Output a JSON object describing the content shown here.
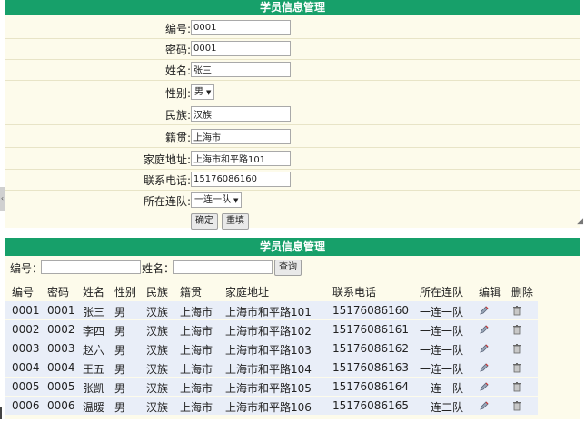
{
  "form": {
    "title": "学员信息管理",
    "fields": [
      {
        "label": "编号:",
        "value": "0001"
      },
      {
        "label": "密码:",
        "value": "0001"
      },
      {
        "label": "姓名:",
        "value": "张三"
      },
      {
        "label": "性别:",
        "value": "男"
      },
      {
        "label": "民族:",
        "value": "汉族"
      },
      {
        "label": "籍贯:",
        "value": "上海市"
      },
      {
        "label": "家庭地址:",
        "value": "上海市和平路101"
      },
      {
        "label": "联系电话:",
        "value": "15176086160"
      },
      {
        "label": "所在连队:",
        "value": "一连一队"
      }
    ],
    "confirm_label": "确定",
    "reset_label": "重填"
  },
  "list": {
    "title": "学员信息管理",
    "search": {
      "id_label": "编号：",
      "id_value": "",
      "name_label": "姓名：",
      "name_value": "",
      "button_label": "查询"
    },
    "headers": [
      "编号",
      "密码",
      "姓名",
      "性别",
      "民族",
      "籍贯",
      "家庭地址",
      "联系电话",
      "所在连队",
      "编辑",
      "删除"
    ],
    "rows": [
      {
        "id": "0001",
        "password": "0001",
        "name": "张三",
        "gender": "男",
        "ethnicity": "汉族",
        "native_place": "上海市",
        "address": "上海市和平路101",
        "phone": "15176086160",
        "team": "一连一队"
      },
      {
        "id": "0002",
        "password": "0002",
        "name": "李四",
        "gender": "男",
        "ethnicity": "汉族",
        "native_place": "上海市",
        "address": "上海市和平路102",
        "phone": "15176086161",
        "team": "一连一队"
      },
      {
        "id": "0003",
        "password": "0003",
        "name": "赵六",
        "gender": "男",
        "ethnicity": "汉族",
        "native_place": "上海市",
        "address": "上海市和平路103",
        "phone": "15176086162",
        "team": "一连一队"
      },
      {
        "id": "0004",
        "password": "0004",
        "name": "王五",
        "gender": "男",
        "ethnicity": "汉族",
        "native_place": "上海市",
        "address": "上海市和平路104",
        "phone": "15176086163",
        "team": "一连一队"
      },
      {
        "id": "0005",
        "password": "0005",
        "name": "张凯",
        "gender": "男",
        "ethnicity": "汉族",
        "native_place": "上海市",
        "address": "上海市和平路105",
        "phone": "15176086164",
        "team": "一连一队"
      },
      {
        "id": "0006",
        "password": "0006",
        "name": "温暖",
        "gender": "男",
        "ethnicity": "汉族",
        "native_place": "上海市",
        "address": "上海市和平路106",
        "phone": "15176086165",
        "team": "一连二队"
      }
    ],
    "edit_icon": "edit-pencil-icon",
    "delete_icon": "trash-icon"
  },
  "colors": {
    "header_green": "#17a06a",
    "panel_bg": "#fdfbeb",
    "row_bg": "#e9eef8"
  }
}
